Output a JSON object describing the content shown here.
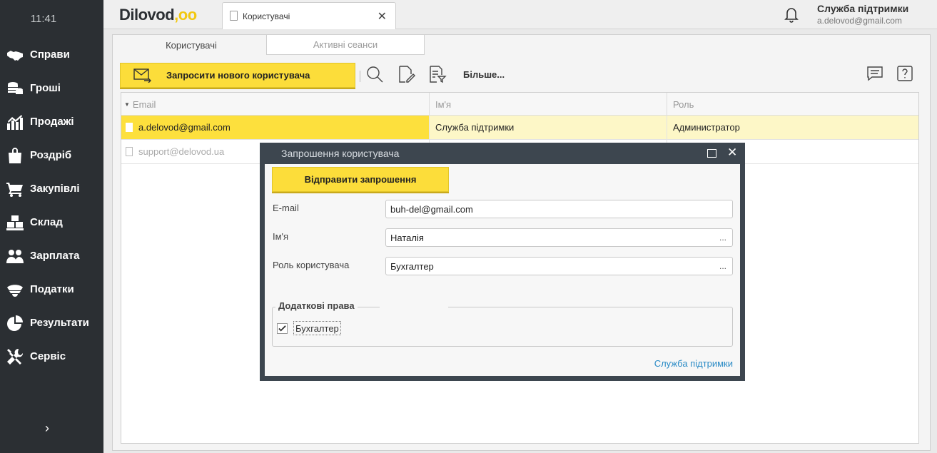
{
  "sidebar": {
    "clock": "11:41",
    "items": [
      {
        "label": "Справи",
        "icon": "handshake-icon"
      },
      {
        "label": "Гроші",
        "icon": "coins-icon"
      },
      {
        "label": "Продажі",
        "icon": "sales-chart-icon"
      },
      {
        "label": "Роздріб",
        "icon": "shopping-bag-icon"
      },
      {
        "label": "Закупівлі",
        "icon": "cart-icon"
      },
      {
        "label": "Склад",
        "icon": "boxes-icon"
      },
      {
        "label": "Зарплата",
        "icon": "people-icon"
      },
      {
        "label": "Податки",
        "icon": "officer-cap-icon"
      },
      {
        "label": "Результати",
        "icon": "pie-chart-icon"
      },
      {
        "label": "Сервіс",
        "icon": "tools-icon"
      }
    ],
    "expand": "›"
  },
  "topbar": {
    "logo": "Dilovod",
    "logo_dots": ",oo",
    "tab_title": "Користувачі",
    "tab_close": "✕",
    "user_name": "Служба підтримки",
    "user_email": "a.delovod@gmail.com"
  },
  "subtabs": {
    "users": "Користувачі",
    "sessions": "Активні сеанси"
  },
  "toolbar": {
    "invite_label": "Запросити нового користувача",
    "more_label": "Більше..."
  },
  "table": {
    "columns": [
      "Email",
      "Ім'я",
      "Роль"
    ],
    "rows": [
      {
        "email": "a.delovod@gmail.com",
        "name": "Служба підтримки",
        "role": "Администратор"
      },
      {
        "email": "support@delovod.ua",
        "name": "",
        "role": ""
      }
    ]
  },
  "modal": {
    "title": "Запрошення користувача",
    "send_label": "Відправити запрошення",
    "email_label": "E-mail",
    "email_value": "buh-del@gmail.com",
    "name_label": "Ім'я",
    "name_value": "Наталія",
    "role_label": "Роль користувача",
    "role_value": "Бухгалтер",
    "dots": "...",
    "group_title": "Додаткові права",
    "checkbox_label": "Бухгалтер",
    "checkbox_checked": true,
    "support_link": "Служба підтримки"
  }
}
